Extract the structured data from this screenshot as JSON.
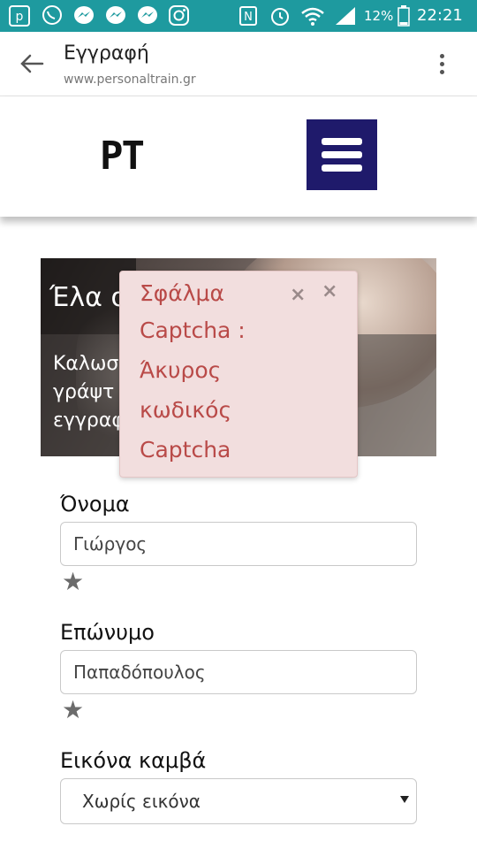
{
  "status_bar": {
    "battery_percent": "12%",
    "time": "22:21",
    "icons": [
      "pinterest-icon",
      "viber-icon",
      "messenger-icon",
      "messenger-icon",
      "messenger-icon",
      "instagram-icon",
      "nfc-icon",
      "alarm-icon",
      "wifi-icon",
      "signal-icon",
      "battery-icon"
    ]
  },
  "app_bar": {
    "title": "Εγγραφή",
    "url": "www.personaltrain.gr"
  },
  "site_header": {
    "logo_text": "PT"
  },
  "hero": {
    "heading": "Έλα σ",
    "subtitle_line1": "Καλωσ                   ες -",
    "subtitle_line2": "γράψτ",
    "subtitle_line3": "εγγραφ"
  },
  "alert": {
    "message_line1": "Σφάλμα",
    "message_line2": "Captcha :",
    "message_line3": "Άκυρος",
    "message_line4": "κωδικός",
    "message_line5": "Captcha",
    "close_glyph": "×"
  },
  "form": {
    "first_name": {
      "label": "Όνομα",
      "value": "Γιώργος"
    },
    "last_name": {
      "label": "Επώνυμο",
      "value": "Παπαδόπουλος"
    },
    "canvas_image": {
      "label": "Εικόνα καμβά",
      "selected": "Χωρίς εικόνα"
    }
  },
  "colors": {
    "status_bar": "#1e9a9f",
    "hamburger": "#1f1a6b",
    "alert_bg": "#f2dede",
    "alert_text": "#b94a48"
  }
}
